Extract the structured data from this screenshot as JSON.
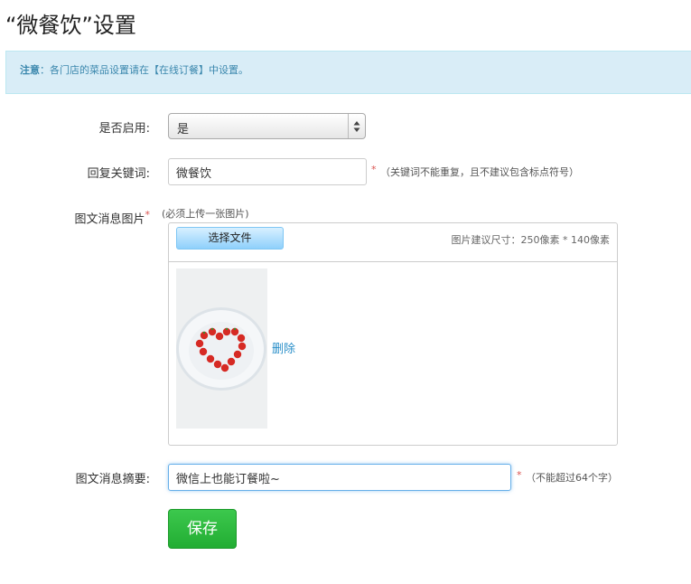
{
  "page": {
    "title": "“微餐饮”设置"
  },
  "notice": {
    "label": "注意",
    "text": "：各门店的菜品设置请在【在线订餐】中设置。"
  },
  "enable": {
    "label": "是否启用:",
    "selected": "是"
  },
  "keyword": {
    "label": "回复关键词:",
    "value": "微餐饮",
    "required": "*",
    "hint": "（关键词不能重复，且不建议包含标点符号）"
  },
  "image": {
    "label": "图文消息图片",
    "required": "*",
    "hint": "(必须上传一张图片)",
    "choose_file": "选择文件",
    "size_hint": "图片建议尺寸：250像素 * 140像素",
    "delete": "删除",
    "thumbnail_icon": "heart-strawberry-plate-image"
  },
  "summary": {
    "label": "图文消息摘要:",
    "value": "微信上也能订餐啦~",
    "required": "*",
    "hint": "（不能超过64个字）"
  },
  "actions": {
    "save": "保存"
  },
  "colors": {
    "notice_bg": "#d9edf7",
    "notice_text": "#3a87ad",
    "required": "#d9534f",
    "link": "#2a8fc9",
    "save_button": "#22ad33"
  }
}
